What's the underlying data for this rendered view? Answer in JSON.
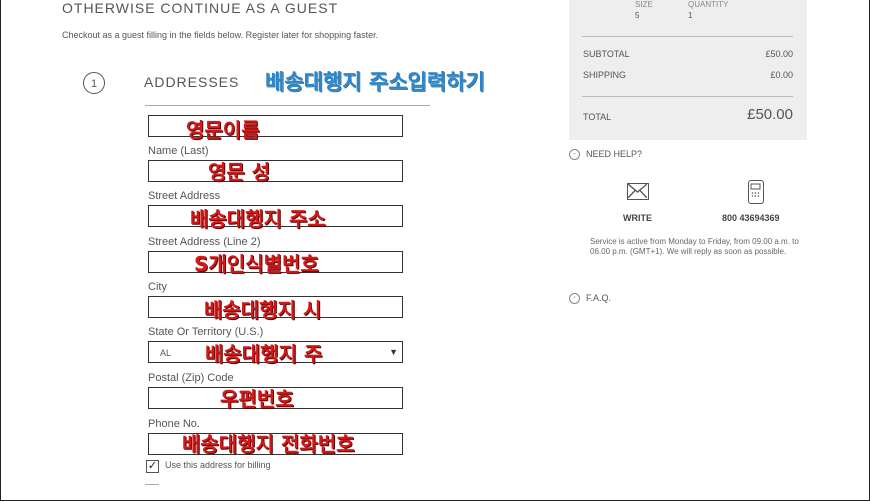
{
  "guest": {
    "heading": "OTHERWISE CONTINUE AS A GUEST",
    "subtext": "Checkout as a guest filling in the fields below. Register later for shopping faster."
  },
  "step": {
    "number": "1",
    "title": "ADDRESSES",
    "annotation": "배송대행지 주소입력하기"
  },
  "form": {
    "fields": [
      {
        "label": "",
        "value": "",
        "annotation": "영문이름"
      },
      {
        "label": "Name (Last)",
        "value": "",
        "annotation": "영문 성"
      },
      {
        "label": "Street Address",
        "value": "",
        "annotation": "배송대행지 주소"
      },
      {
        "label": "Street Address (Line 2)",
        "value": "",
        "annotation": "S개인식별번호"
      },
      {
        "label": "City",
        "value": "",
        "annotation": "배송대행지 시"
      },
      {
        "label": "State Or Territory (U.S.)",
        "value": "AL",
        "annotation": "배송대행지 주"
      },
      {
        "label": "Postal (Zip) Code",
        "value": "",
        "annotation": "우편번호"
      },
      {
        "label": "Phone No.",
        "value": "",
        "annotation": "배송대행지 전화번호"
      }
    ],
    "billing_checkbox": {
      "checked": true,
      "label": "Use this address for billing"
    }
  },
  "summary": {
    "size_header": "SIZE",
    "quantity_header": "QUANTITY",
    "size": "5",
    "quantity": "1",
    "subtotal_label": "SUBTOTAL",
    "subtotal": "£50.00",
    "shipping_label": "SHIPPING",
    "shipping": "£0.00",
    "total_label": "TOTAL",
    "total": "£50.00"
  },
  "help": {
    "title": "NEED HELP?",
    "write_label": "WRITE",
    "phone": "800 43694369",
    "service_text": "Service is active from Monday to Friday, from 09.00 a.m. to 06.00 p.m. (GMT+1). We will reply as soon as possible.",
    "faq": "F.A.Q."
  },
  "colors": {
    "annotation_blue": "#2a86c9",
    "annotation_red": "#d31a1a",
    "summary_bg": "#eeeeee"
  }
}
